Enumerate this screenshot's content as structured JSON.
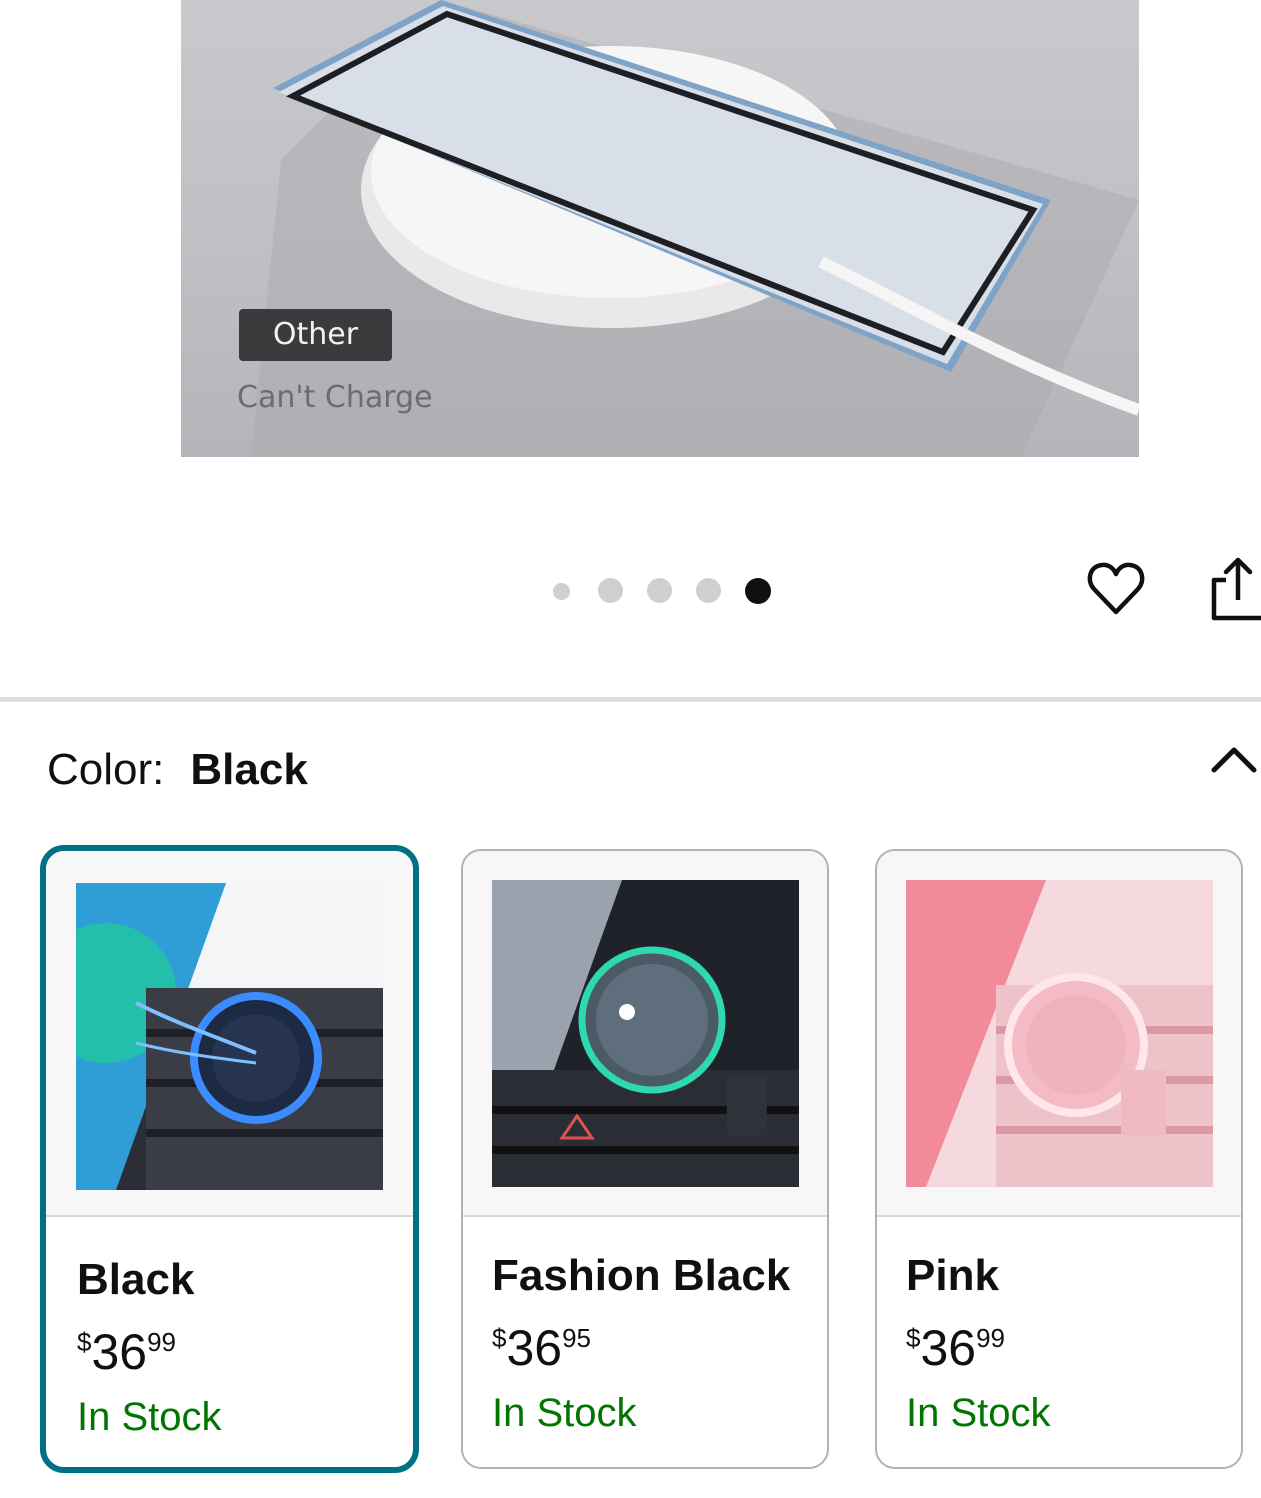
{
  "hero": {
    "badge": "Other",
    "caption": "Can't Charge"
  },
  "carousel": {
    "count": 5,
    "active_index": 4
  },
  "actions": {
    "favorite_icon": "heart-icon",
    "share_icon": "share-icon"
  },
  "color_selector": {
    "label": "Color:",
    "selected": "Black",
    "toggle_icon": "chevron-up-icon"
  },
  "variants": [
    {
      "name": "Black",
      "currency": "$",
      "price_whole": "36",
      "price_fraction": "99",
      "availability": "In Stock",
      "selected": true
    },
    {
      "name": "Fashion Black",
      "currency": "$",
      "price_whole": "36",
      "price_fraction": "95",
      "availability": "In Stock",
      "selected": false
    },
    {
      "name": "Pink",
      "currency": "$",
      "price_whole": "36",
      "price_fraction": "99",
      "availability": "In Stock",
      "selected": false
    }
  ],
  "colors": {
    "selected_border": "#007185",
    "in_stock": "#007600",
    "active_dot": "#0f1111",
    "inactive_dot": "#cfcfcf"
  }
}
